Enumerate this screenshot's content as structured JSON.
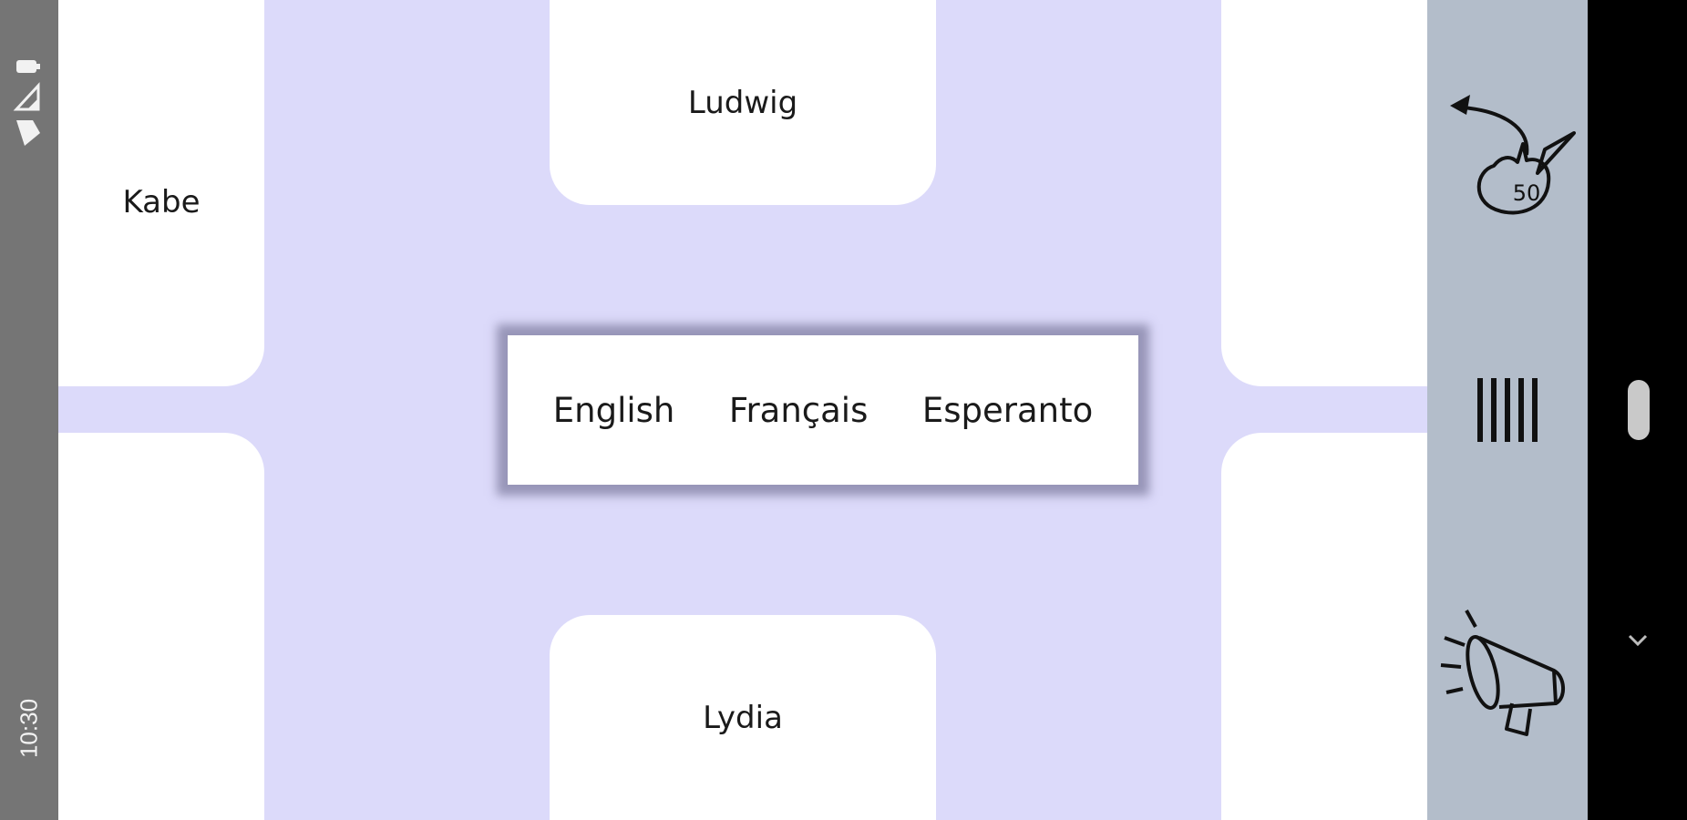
{
  "status_bar": {
    "time": "10:30",
    "icons": [
      "wifi-icon",
      "signal-icon",
      "battery-icon"
    ]
  },
  "cards": {
    "left_top": "Kabe",
    "left_bottom": "",
    "top": "Ludwig",
    "bottom": "Lydia",
    "right_top": "",
    "right_bottom": ""
  },
  "language_menu": {
    "options": [
      "English",
      "Français",
      "Esperanto"
    ]
  },
  "toolbar": {
    "items": [
      {
        "icon": "bomb-count-icon",
        "badge": "50"
      },
      {
        "icon": "tally-marks-icon"
      },
      {
        "icon": "megaphone-icon"
      }
    ]
  },
  "nav_bar": {
    "icons": [
      "scroll-handle",
      "chevron-down-icon"
    ]
  },
  "colors": {
    "background": "#dcdafa",
    "card": "#ffffff",
    "toolbar": "#b3bdca",
    "status_bar": "#757575",
    "nav_bar": "#000000"
  }
}
